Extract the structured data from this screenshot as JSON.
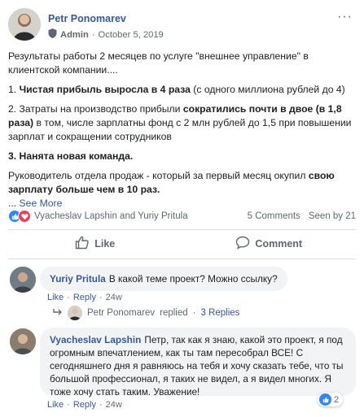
{
  "post": {
    "author": "Petr Ponomarev",
    "role": "Admin",
    "date": "October 5, 2019",
    "menu": "···",
    "intro": "Результаты работы 2 месяцев по услуге \"внешнее управление\" в клиентской компании....",
    "p1_lead": "1. ",
    "p1_bold": "Чистая прибыль выросла в 4 раза",
    "p1_rest": " (с одного миллиона рублей до 4)",
    "p2_lead": "2. Затраты на производство прибыли ",
    "p2_bold": "сократились почти в двое (в 1,8 раза)",
    "p2_rest": " в том, числе зарплатны фонд с 2 млн рублей до 1,5 при повышении зарплат и сокращении сотрудников",
    "p3_bold": "3. Нанята новая команда.",
    "p4_lead": "Руководитель отдела продаж - который за первый месяц окупил ",
    "p4_bold": "свою зарплату больше чем в 10 раз.",
    "see_more_prefix": "... ",
    "see_more": "See More"
  },
  "reactions": {
    "names": "Vyacheslav Lapshin and Yuriy Pritula",
    "comments": "5 Comments",
    "seen": "Seen by 21"
  },
  "actions": {
    "like": "Like",
    "comment": "Comment"
  },
  "comments": [
    {
      "name": "Yuriy Pritula",
      "text": "В какой теме проект? Можно ссылку?",
      "like": "Like",
      "reply": "Reply",
      "time": "24w"
    },
    {
      "name": "Vyacheslav Lapshin",
      "text": "Петр, так как я знаю, какой это проект, я под огромным впечатлением, как ты там пересобрал ВСЕ! С сегодняшнего дня я равняюсь на тебя и хочу сказать тебе, что ты большой профессионал, я таких не видел, а я видел многих. Я тоже хочу стать таким. Уважение!",
      "like": "Like",
      "reply": "Reply",
      "time": "24w",
      "reaction_count": "2"
    }
  ],
  "replies": {
    "name": "Petr Ponomarev",
    "replied": "replied",
    "dot": "·",
    "count": "3 Replies"
  },
  "colors": {
    "link": "#385898",
    "meta": "#606770",
    "like_blue": "#2d88ff",
    "love_red": "#f33e58",
    "bubble": "#f2f3f5"
  }
}
